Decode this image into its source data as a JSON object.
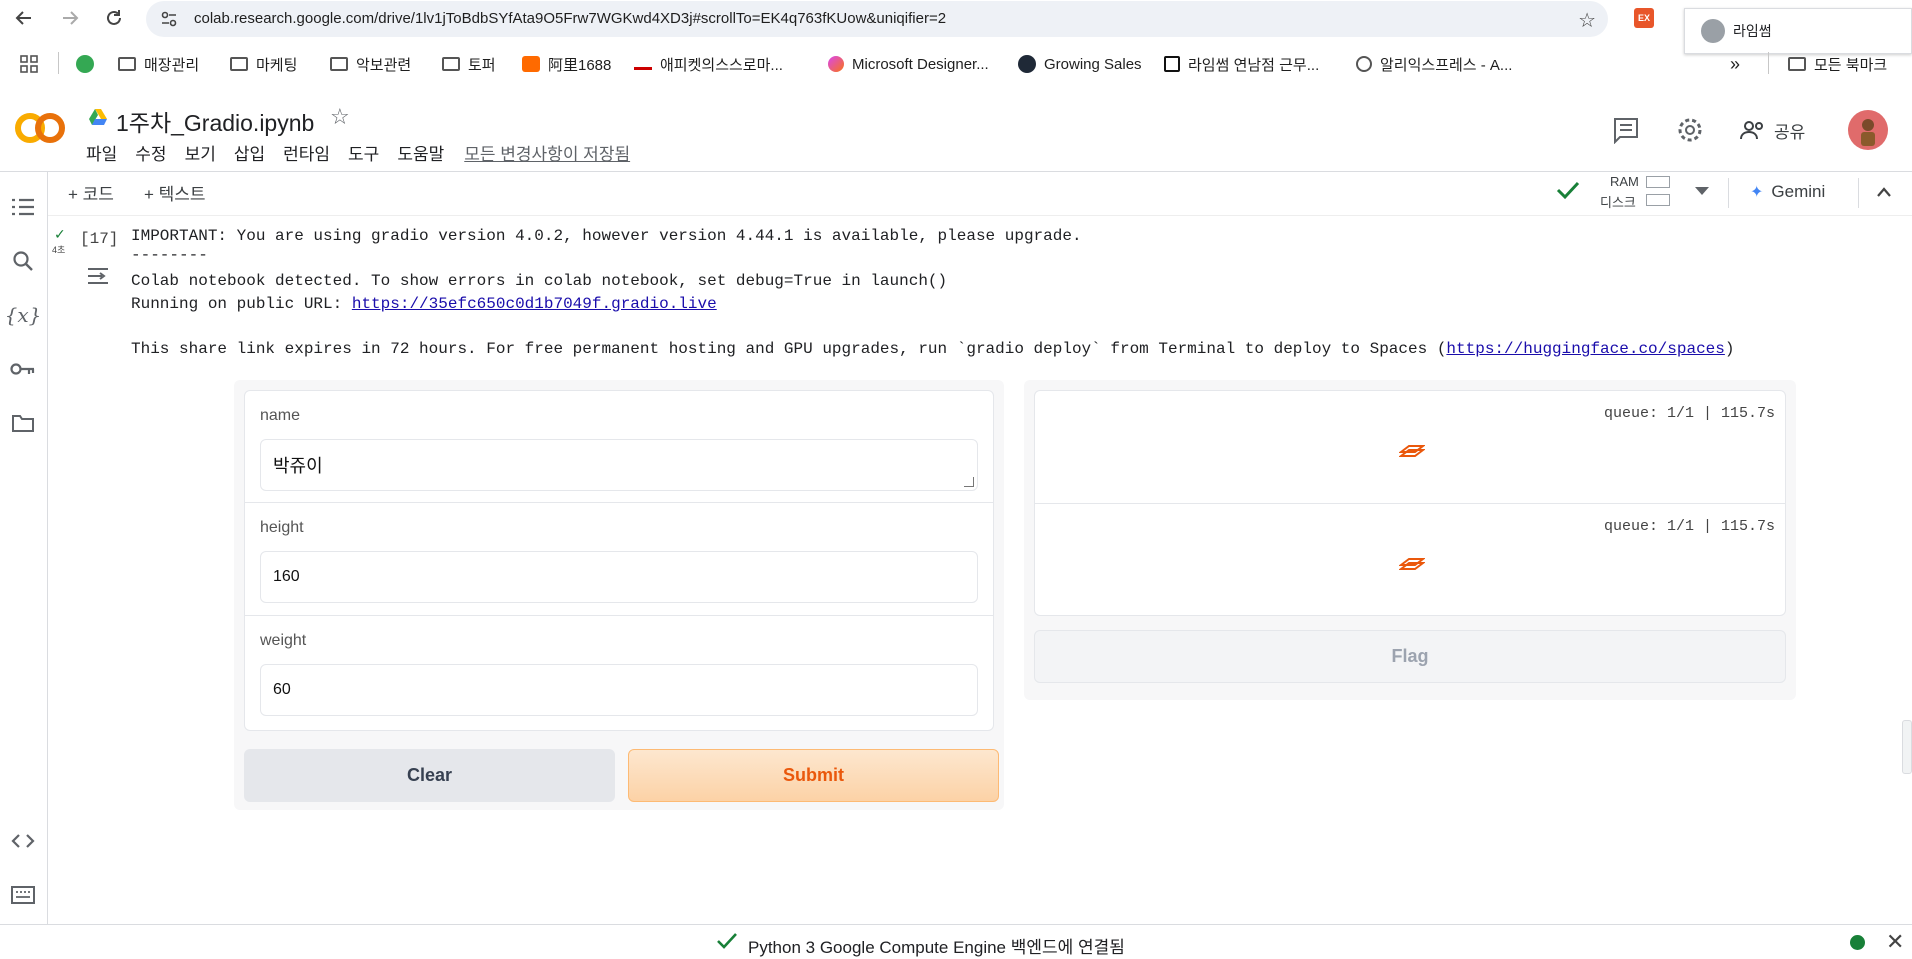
{
  "browser": {
    "url": "colab.research.google.com/drive/1lv1jToBdbSYfAta9O5Frw7WGKwd4XD3j#scrollTo=EK4q763fKUow&uniqifier=2",
    "profile_popup_label": "라임썸",
    "extension_label": "EX"
  },
  "bookmarks": {
    "items": [
      {
        "label": "매장관리",
        "icon": "folder-icon"
      },
      {
        "label": "마케팅",
        "icon": "folder-icon"
      },
      {
        "label": "악보관련",
        "icon": "folder-icon"
      },
      {
        "label": "토퍼",
        "icon": "folder-icon"
      },
      {
        "label": "阿里1688",
        "icon": "alibaba-icon"
      },
      {
        "label": "애피켓의스스로마...",
        "icon": "site-icon"
      },
      {
        "label": "Microsoft Designer...",
        "icon": "designer-icon"
      },
      {
        "label": "Growing Sales",
        "icon": "growing-icon"
      },
      {
        "label": "라임썸 연남점 근무...",
        "icon": "notion-icon"
      },
      {
        "label": "알리익스프레스 - A...",
        "icon": "globe-icon"
      }
    ],
    "more_label": "»",
    "all_bookmarks": "모든 북마크"
  },
  "colab": {
    "title": "1주차_Gradio.ipynb",
    "menu": [
      "파일",
      "수정",
      "보기",
      "삽입",
      "런타임",
      "도구",
      "도움말"
    ],
    "saved_status": "모든 변경사항이 저장됨",
    "share_label": "공유",
    "toolbar": {
      "add_code": "+ 코드",
      "add_text": "+ 텍스트",
      "ram_label": "RAM",
      "disk_label": "디스크",
      "gemini_label": "Gemini"
    }
  },
  "cell": {
    "exec_count": "[17]",
    "run_time": "4초",
    "output_lines": {
      "line1": "IMPORTANT: You are using gradio version 4.0.2, however version 4.44.1 is available, please upgrade.",
      "line2": "--------",
      "line3": "Colab notebook detected. To show errors in colab notebook, set debug=True in launch()",
      "line4_prefix": "Running on public URL: ",
      "line4_link": "https://35efc650c0d1b7049f.gradio.live",
      "line5_prefix": "This share link expires in 72 hours. For free permanent hosting and GPU upgrades, run `gradio deploy` from Terminal to deploy to Spaces (",
      "line5_link": "https://huggingface.co/spaces",
      "line5_suffix": ")"
    }
  },
  "gradio": {
    "inputs": [
      {
        "label": "name",
        "value": "박쥬이"
      },
      {
        "label": "height",
        "value": "160"
      },
      {
        "label": "weight",
        "value": "60"
      }
    ],
    "clear_label": "Clear",
    "submit_label": "Submit",
    "outputs": [
      {
        "queue": "queue: 1/1 | 115.7s"
      },
      {
        "queue": "queue: 1/1 | 115.7s"
      }
    ],
    "flag_label": "Flag",
    "accent_color": "#ea580c"
  },
  "status": {
    "text": "Python 3 Google Compute Engine 백엔드에 연결됨"
  }
}
